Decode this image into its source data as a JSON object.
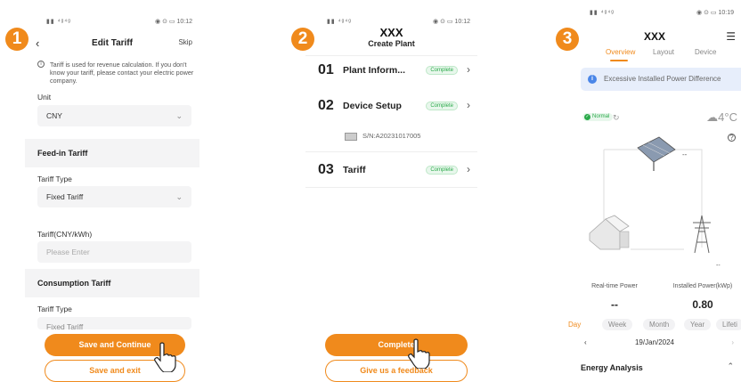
{
  "colors": {
    "accent": "#f08a1c",
    "complete": "#2aaa4a",
    "alert_bg": "#e7eefb"
  },
  "step_badges": [
    "1",
    "2",
    "3"
  ],
  "status_bar": {
    "p1_time": "10:12",
    "p2_time": "10:12",
    "p3_time": "10:19"
  },
  "panel1": {
    "title": "Edit Tariff",
    "skip": "Skip",
    "info": "Tariff is used for revenue calculation. If you don't know your tariff, please contact your electric power company.",
    "unit_label": "Unit",
    "unit_value": "CNY",
    "feed_in_section": "Feed-in Tariff",
    "tariff_type_label": "Tariff Type",
    "tariff_type_value": "Fixed Tariff",
    "tariff_label": "Tariff(CNY/kWh)",
    "tariff_placeholder": "Please Enter",
    "consumption_section": "Consumption Tariff",
    "consumption_type_label": "Tariff Type",
    "consumption_type_value": "Fixed Tariff",
    "primary_button": "Save and Continue",
    "secondary_button": "Save and exit"
  },
  "panel2": {
    "plant_name": "XXX",
    "title": "Create Plant",
    "steps": [
      {
        "num": "01",
        "name": "Plant Inform...",
        "status": "Complete"
      },
      {
        "num": "02",
        "name": "Device Setup",
        "status": "Complete"
      },
      {
        "num": "03",
        "name": "Tariff",
        "status": "Complete"
      }
    ],
    "serial": "S/N:A20231017005",
    "primary_button": "Complete",
    "secondary_button": "Give us a feedback"
  },
  "panel3": {
    "plant_name": "XXX",
    "tabs": [
      "Overview",
      "Layout",
      "Device"
    ],
    "alert": "Excessive Installed Power Difference",
    "normal": "Normal",
    "temperature": "4°C",
    "pv_value": "--",
    "grid_value": "--",
    "realtime_power_label": "Real-time Power",
    "realtime_power_value": "--",
    "installed_power_label": "Installed Power(kWp)",
    "installed_power_value": "0.80",
    "period_tabs": [
      "Day",
      "Week",
      "Month",
      "Year",
      "Lifeti"
    ],
    "date": "19/Jan/2024",
    "section": "Energy Analysis"
  }
}
